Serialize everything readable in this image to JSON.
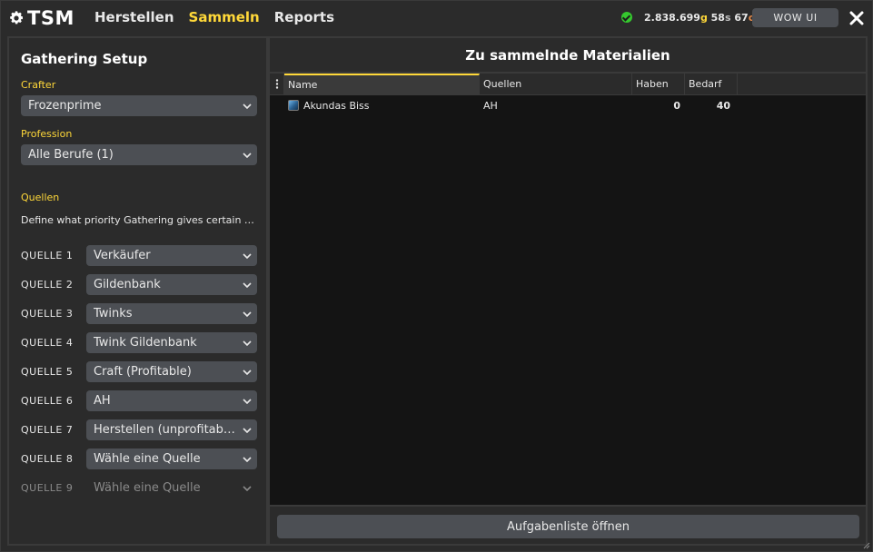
{
  "app": {
    "logo_text": "TSM"
  },
  "nav": {
    "items": [
      "Herstellen",
      "Sammeln",
      "Reports"
    ],
    "active": "Sammeln"
  },
  "status": {
    "gold": "2.838.699",
    "gold_unit": "g",
    "silver": "58",
    "silver_unit": "s",
    "copper": "67",
    "copper_unit": "c",
    "status_color": "#35c82e"
  },
  "header_buttons": {
    "wow_ui_label": "WOW UI"
  },
  "left": {
    "title": "Gathering Setup",
    "crafter_label": "Crafter",
    "crafter_value": "Frozenprime",
    "profession_label": "Profession",
    "profession_value": "Alle Berufe (1)",
    "sources_label": "Quellen",
    "sources_desc": "Define what priority Gathering gives certain sources.",
    "sources": [
      {
        "label": "QUELLE 1",
        "value": "Verkäufer"
      },
      {
        "label": "QUELLE 2",
        "value": "Gildenbank"
      },
      {
        "label": "QUELLE 3",
        "value": "Twinks"
      },
      {
        "label": "QUELLE 4",
        "value": "Twink Gildenbank"
      },
      {
        "label": "QUELLE 5",
        "value": "Craft (Profitable)"
      },
      {
        "label": "QUELLE 6",
        "value": "AH"
      },
      {
        "label": "QUELLE 7",
        "value": "Herstellen (unprofitabel)"
      },
      {
        "label": "QUELLE 8",
        "value": "Wähle eine Quelle"
      },
      {
        "label": "QUELLE 9",
        "value": "Wähle eine Quelle"
      }
    ]
  },
  "right": {
    "title": "Zu sammelnde Materialien",
    "columns": {
      "name": "Name",
      "sources": "Quellen",
      "have": "Haben",
      "need": "Bedarf"
    },
    "rows": [
      {
        "icon": "item-gem-icon",
        "name": "Akundas Biss",
        "sources": "AH",
        "have": "0",
        "need": "40"
      }
    ],
    "task_button": "Aufgabenliste öffnen"
  },
  "colors": {
    "accent": "#ffd839",
    "background": "#2b2b2b",
    "control": "#4c4f54",
    "table_bg": "#141414"
  }
}
